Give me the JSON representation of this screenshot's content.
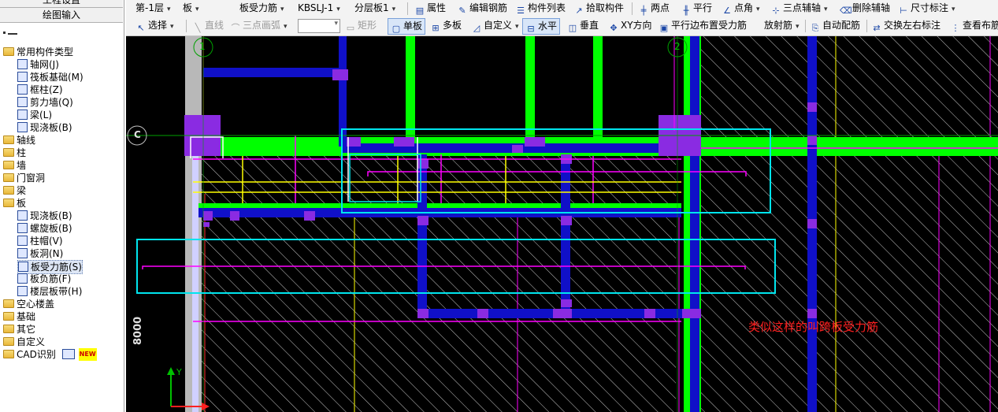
{
  "left_panel": {
    "top_button_partial": "工程设置",
    "draw_input_button": "绘图输入",
    "tree": {
      "root_label": "常用构件类型",
      "common_items": [
        {
          "label": "轴网(J)",
          "icon": "grid-axis-icon"
        },
        {
          "label": "筏板基础(M)",
          "icon": "raft-foundation-icon"
        },
        {
          "label": "框柱(Z)",
          "icon": "frame-column-icon"
        },
        {
          "label": "剪力墙(Q)",
          "icon": "shear-wall-icon"
        },
        {
          "label": "梁(L)",
          "icon": "beam-icon"
        },
        {
          "label": "现浇板(B)",
          "icon": "cast-slab-icon"
        }
      ],
      "groups_before_slab": [
        "轴线",
        "柱",
        "墙",
        "门窗洞",
        "梁"
      ],
      "slab_group": "板",
      "slab_items": [
        {
          "label": "现浇板(B)",
          "icon": "cast-slab-icon"
        },
        {
          "label": "螺旋板(B)",
          "icon": "spiral-slab-icon"
        },
        {
          "label": "柱帽(V)",
          "icon": "column-cap-icon"
        },
        {
          "label": "板洞(N)",
          "icon": "slab-hole-icon"
        },
        {
          "label": "板受力筋(S)",
          "icon": "slab-main-rebar-icon",
          "selected": true
        },
        {
          "label": "板负筋(F)",
          "icon": "slab-negative-rebar-icon"
        },
        {
          "label": "楼层板带(H)",
          "icon": "floor-slab-strip-icon"
        }
      ],
      "groups_after_slab": [
        "空心楼盖",
        "基础",
        "其它",
        "自定义"
      ],
      "cad_item": "CAD识别",
      "cad_badge": "NEW"
    }
  },
  "toolbar1": {
    "floor": "第-1层",
    "category": "板",
    "component_type": "板受力筋",
    "component_name": "KBSLJ-1",
    "layer": "分层板1",
    "items": [
      "属性",
      "编辑钢筋",
      "构件列表",
      "拾取构件",
      "两点",
      "平行",
      "点角",
      "三点辅轴",
      "删除辅轴",
      "尺寸标注"
    ]
  },
  "toolbar2": {
    "select": "选择",
    "line": "直线",
    "arc": "三点画弧",
    "rect": "矩形",
    "single_slab": "单板",
    "multi_slab": "多板",
    "custom": "自定义",
    "horizontal": "水平",
    "vertical": "垂直",
    "xy_direction": "XY方向",
    "parallel_edge": "平行边布置受力筋",
    "radial": "放射筋",
    "auto_rebar": "自动配筋",
    "swap_labels": "交换左右标注",
    "view_partial": "查看布筋"
  },
  "canvas": {
    "axis_labels": [
      "1",
      "2",
      "C"
    ],
    "dimension": "8000",
    "annotation": "类似这样的叫跨板受力筋",
    "ucs_y": "Y",
    "colors": {
      "background": "#000000",
      "beam_green": "#00ff00",
      "beam_blue": "#0000cc",
      "column_purple": "#8a2be2",
      "rebar_magenta": "#ff00ff",
      "rebar_yellow": "#ffff00",
      "highlight_cyan": "#00e5ee",
      "annotation_red": "#ff2020"
    }
  }
}
